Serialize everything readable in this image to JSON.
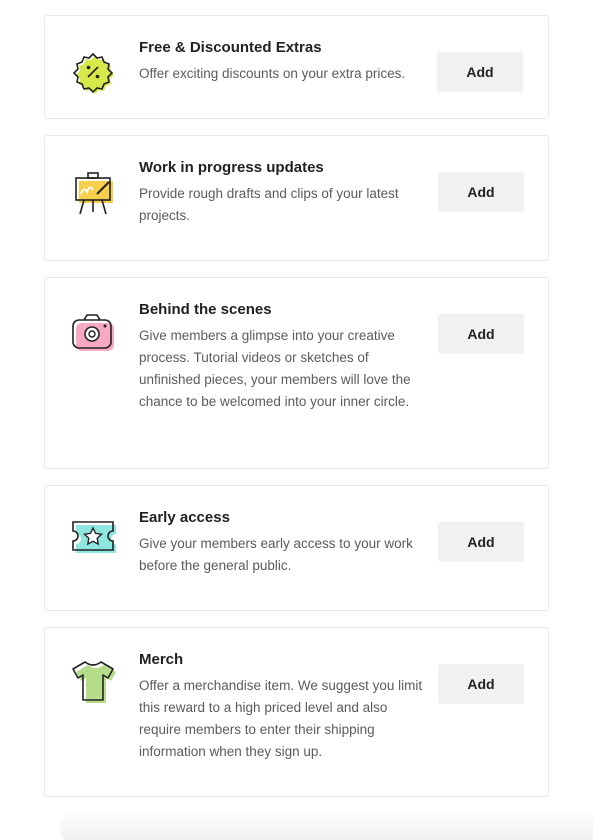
{
  "rewards": [
    {
      "title": "Free & Discounted Extras",
      "description": "Offer exciting discounts on your extra prices.",
      "button_label": "Add",
      "icon": "discount-badge-icon",
      "accent": "#d7e84a"
    },
    {
      "title": "Work in progress updates",
      "description": "Provide rough drafts and clips of your latest projects.",
      "button_label": "Add",
      "icon": "easel-icon",
      "accent": "#f7cf4a"
    },
    {
      "title": "Behind the scenes",
      "description": "Give members a glimpse into your creative process. Tutorial videos or sketches of unfinished pieces, your members will love the chance to be welcomed into your inner circle.",
      "button_label": "Add",
      "icon": "camera-icon",
      "accent": "#f6a9c3"
    },
    {
      "title": "Early access",
      "description": "Give your members early access to your work before the general public.",
      "button_label": "Add",
      "icon": "ticket-star-icon",
      "accent": "#8fe6df"
    },
    {
      "title": "Merch",
      "description": "Offer a merchandise item. We suggest you limit this reward to a high priced level and also require members to enter their shipping information when they sign up.",
      "button_label": "Add",
      "icon": "t-shirt-icon",
      "accent": "#b5dd8a"
    }
  ]
}
